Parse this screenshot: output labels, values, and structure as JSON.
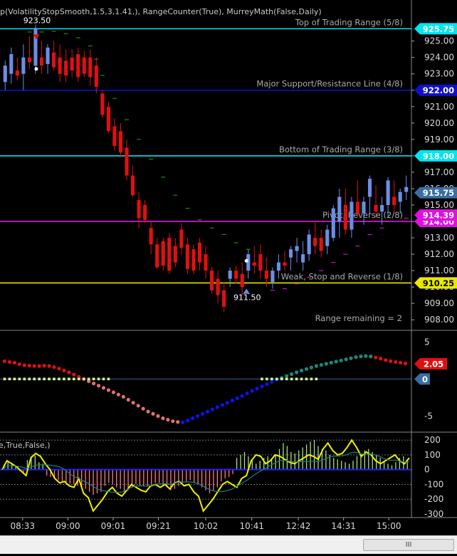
{
  "indicator_title": "p(VolatilityStopSmooth,1.5,3,1.41,),  RangeCounter(True),  MurreyMath(False,Daily)",
  "osc_title": "e,True,False,)",
  "colors": {
    "bull": "#6b8ee6",
    "bear": "#e01010",
    "cyan": "#00e5ee",
    "navy": "#1010cc",
    "magenta": "#e010e0",
    "yellow": "#e8e800",
    "price_tag": "#3a6ea5"
  },
  "scrollbar": {
    "thumb_label": "III"
  },
  "chart_data": [
    {
      "type": "candlestick",
      "name": "price",
      "y_axis_ticks": [
        908,
        909,
        910,
        911,
        912,
        913,
        914,
        915,
        916,
        917,
        918,
        919,
        920,
        921,
        922,
        923,
        924,
        925
      ],
      "y_tick_labels": [
        "908.00",
        "909.00",
        "910.00",
        "911.00",
        "912.00",
        "913.00",
        "914.00",
        "915.00",
        "916.00",
        "917.00",
        "918.00",
        "919.00",
        "920.00",
        "921.00",
        "922.00",
        "923.00",
        "924.00",
        "925.00"
      ],
      "ylim": [
        907.75,
        926.2
      ],
      "x_tick_labels": [
        "08:33",
        "09:00",
        "09:01",
        "09:21",
        "10:02",
        "10:41",
        "12:42",
        "14:31",
        "15:00"
      ],
      "murrey_lines": [
        {
          "label": "Top of Trading Range (5/8)",
          "value": 925.75,
          "tag": "925.75",
          "color": "cyan"
        },
        {
          "label": "Major Support/Resistance Line (4/8)",
          "value": 922.0,
          "tag": "922.00",
          "color": "navy"
        },
        {
          "label": "Bottom of Trading Range (3/8)",
          "value": 918.0,
          "tag": "918.00",
          "color": "cyan"
        },
        {
          "label": "Pivot, Reverse (2/8)",
          "value": 914.0,
          "tag": "914.00",
          "color": "magenta"
        },
        {
          "label": "Weak, Stop and Reverse (1/8)",
          "value": 910.25,
          "tag": "910.25",
          "color": "yellow"
        }
      ],
      "price_tags": [
        {
          "value": 915.75,
          "tag": "915.75",
          "color": "#3a6ea5"
        },
        {
          "value": 914.39,
          "tag": "914.39",
          "color": "#e010e0"
        }
      ],
      "annotations": [
        {
          "text": "923.50",
          "x_index": 5,
          "y": 926.1
        },
        {
          "text": "911.50",
          "x_index": 39,
          "y": 909.2
        }
      ],
      "range_text": "Range remaining = 2",
      "candles": [
        {
          "o": 922.5,
          "h": 923.8,
          "l": 922.0,
          "c": 923.5
        },
        {
          "o": 923.0,
          "h": 924.6,
          "l": 922.4,
          "c": 924.2
        },
        {
          "o": 923.2,
          "h": 924.0,
          "l": 922.6,
          "c": 922.9
        },
        {
          "o": 923.0,
          "h": 924.8,
          "l": 922.0,
          "c": 924.0
        },
        {
          "o": 924.0,
          "h": 925.3,
          "l": 923.3,
          "c": 923.7
        },
        {
          "o": 923.5,
          "h": 926.0,
          "l": 923.0,
          "c": 925.8
        },
        {
          "o": 924.0,
          "h": 925.0,
          "l": 923.0,
          "c": 923.5
        },
        {
          "o": 923.6,
          "h": 924.8,
          "l": 923.0,
          "c": 924.6
        },
        {
          "o": 924.3,
          "h": 925.0,
          "l": 923.2,
          "c": 923.4
        },
        {
          "o": 924.0,
          "h": 924.8,
          "l": 922.5,
          "c": 923.0
        },
        {
          "o": 923.8,
          "h": 924.5,
          "l": 922.5,
          "c": 922.9
        },
        {
          "o": 924.0,
          "h": 924.5,
          "l": 922.8,
          "c": 923.2
        },
        {
          "o": 924.2,
          "h": 924.6,
          "l": 922.5,
          "c": 922.8
        },
        {
          "o": 924.0,
          "h": 924.4,
          "l": 922.8,
          "c": 923.0
        },
        {
          "o": 924.0,
          "h": 924.5,
          "l": 922.3,
          "c": 922.8
        },
        {
          "o": 923.5,
          "h": 924.0,
          "l": 921.8,
          "c": 922.2
        },
        {
          "o": 921.8,
          "h": 922.0,
          "l": 920.3,
          "c": 920.5
        },
        {
          "o": 921.0,
          "h": 921.3,
          "l": 919.4,
          "c": 919.5
        },
        {
          "o": 919.8,
          "h": 920.3,
          "l": 918.3,
          "c": 918.6
        },
        {
          "o": 919.5,
          "h": 920.0,
          "l": 917.9,
          "c": 918.2
        },
        {
          "o": 918.5,
          "h": 919.0,
          "l": 916.5,
          "c": 916.8
        },
        {
          "o": 916.8,
          "h": 917.4,
          "l": 915.5,
          "c": 915.6
        },
        {
          "o": 915.3,
          "h": 915.8,
          "l": 913.6,
          "c": 914.2
        },
        {
          "o": 915.0,
          "h": 915.3,
          "l": 913.9,
          "c": 914.1
        },
        {
          "o": 913.6,
          "h": 914.0,
          "l": 912.0,
          "c": 912.6
        },
        {
          "o": 912.6,
          "h": 913.0,
          "l": 911.1,
          "c": 911.2
        },
        {
          "o": 912.8,
          "h": 913.0,
          "l": 911.0,
          "c": 911.3
        },
        {
          "o": 913.0,
          "h": 913.3,
          "l": 910.8,
          "c": 911.0
        },
        {
          "o": 912.5,
          "h": 913.0,
          "l": 911.2,
          "c": 911.5
        },
        {
          "o": 913.5,
          "h": 913.9,
          "l": 912.0,
          "c": 912.4
        },
        {
          "o": 912.6,
          "h": 913.0,
          "l": 910.8,
          "c": 911.1
        },
        {
          "o": 912.3,
          "h": 912.6,
          "l": 910.8,
          "c": 911.0
        },
        {
          "o": 912.7,
          "h": 913.0,
          "l": 911.0,
          "c": 911.5
        },
        {
          "o": 912.0,
          "h": 912.5,
          "l": 910.5,
          "c": 911.0
        },
        {
          "o": 911.0,
          "h": 911.2,
          "l": 909.6,
          "c": 909.8
        },
        {
          "o": 910.5,
          "h": 911.0,
          "l": 909.0,
          "c": 909.5
        },
        {
          "o": 909.8,
          "h": 910.3,
          "l": 908.5,
          "c": 908.8
        },
        {
          "o": 910.5,
          "h": 911.2,
          "l": 910.0,
          "c": 911.0
        },
        {
          "o": 911.0,
          "h": 911.3,
          "l": 910.2,
          "c": 910.5
        },
        {
          "o": 910.8,
          "h": 911.5,
          "l": 909.5,
          "c": 910.0
        },
        {
          "o": 911.0,
          "h": 912.3,
          "l": 910.5,
          "c": 912.0
        },
        {
          "o": 911.5,
          "h": 912.5,
          "l": 910.8,
          "c": 911.3
        },
        {
          "o": 912.0,
          "h": 912.6,
          "l": 910.5,
          "c": 911.0
        },
        {
          "o": 911.0,
          "h": 911.8,
          "l": 910.0,
          "c": 910.5
        },
        {
          "o": 910.3,
          "h": 911.2,
          "l": 909.9,
          "c": 911.0
        },
        {
          "o": 911.0,
          "h": 912.0,
          "l": 910.5,
          "c": 911.5
        },
        {
          "o": 911.5,
          "h": 912.2,
          "l": 911.0,
          "c": 911.3
        },
        {
          "o": 911.8,
          "h": 912.5,
          "l": 911.0,
          "c": 912.3
        },
        {
          "o": 912.2,
          "h": 913.0,
          "l": 911.5,
          "c": 912.5
        },
        {
          "o": 911.5,
          "h": 912.8,
          "l": 911.0,
          "c": 912.0
        },
        {
          "o": 912.0,
          "h": 913.5,
          "l": 911.6,
          "c": 913.2
        },
        {
          "o": 913.0,
          "h": 914.0,
          "l": 912.0,
          "c": 912.5
        },
        {
          "o": 913.0,
          "h": 913.5,
          "l": 911.8,
          "c": 912.2
        },
        {
          "o": 912.5,
          "h": 913.8,
          "l": 912.0,
          "c": 913.5
        },
        {
          "o": 913.0,
          "h": 915.0,
          "l": 912.8,
          "c": 914.8
        },
        {
          "o": 914.0,
          "h": 916.0,
          "l": 913.0,
          "c": 915.5
        },
        {
          "o": 915.0,
          "h": 916.0,
          "l": 913.2,
          "c": 913.5
        },
        {
          "o": 913.5,
          "h": 915.5,
          "l": 913.0,
          "c": 915.2
        },
        {
          "o": 915.2,
          "h": 916.5,
          "l": 914.3,
          "c": 914.5
        },
        {
          "o": 914.5,
          "h": 915.5,
          "l": 913.8,
          "c": 915.2
        },
        {
          "o": 915.5,
          "h": 916.8,
          "l": 914.5,
          "c": 916.6
        },
        {
          "o": 915.0,
          "h": 916.2,
          "l": 914.2,
          "c": 914.6
        },
        {
          "o": 914.6,
          "h": 915.5,
          "l": 913.8,
          "c": 915.0
        },
        {
          "o": 915.0,
          "h": 916.7,
          "l": 914.3,
          "c": 916.5
        },
        {
          "o": 915.5,
          "h": 916.5,
          "l": 914.6,
          "c": 915.0
        },
        {
          "o": 915.2,
          "h": 916.0,
          "l": 914.5,
          "c": 915.8
        },
        {
          "o": 915.8,
          "h": 916.8,
          "l": 915.3,
          "c": 916.1
        }
      ],
      "stop_line": [
        {
          "x_index": 4,
          "y": 925.55,
          "side": "above"
        },
        {
          "x_index": 6,
          "y": 925.55,
          "side": "above"
        },
        {
          "x_index": 8,
          "y": 925.6,
          "side": "above"
        },
        {
          "x_index": 10,
          "y": 925.45,
          "side": "above"
        },
        {
          "x_index": 12,
          "y": 925.2,
          "side": "above"
        },
        {
          "x_index": 14,
          "y": 924.7,
          "side": "above"
        },
        {
          "x_index": 15,
          "y": 923.9,
          "side": "above"
        },
        {
          "x_index": 16,
          "y": 922.9,
          "side": "above"
        },
        {
          "x_index": 18,
          "y": 921.5,
          "side": "above"
        },
        {
          "x_index": 20,
          "y": 920.2,
          "side": "above"
        },
        {
          "x_index": 22,
          "y": 919.0,
          "side": "above"
        },
        {
          "x_index": 24,
          "y": 917.8,
          "side": "above"
        },
        {
          "x_index": 26,
          "y": 916.7,
          "side": "above"
        },
        {
          "x_index": 28,
          "y": 915.6,
          "side": "above"
        },
        {
          "x_index": 30,
          "y": 914.8,
          "side": "above"
        },
        {
          "x_index": 32,
          "y": 914.1,
          "side": "above"
        },
        {
          "x_index": 34,
          "y": 913.6,
          "side": "above"
        },
        {
          "x_index": 36,
          "y": 913.2,
          "side": "above"
        },
        {
          "x_index": 38,
          "y": 912.7,
          "side": "above"
        },
        {
          "x_index": 40,
          "y": 912.3,
          "side": "above"
        },
        {
          "x_index": 42,
          "y": 911.5,
          "side": "above"
        },
        {
          "x_index": 44,
          "y": 909.8,
          "side": "below"
        },
        {
          "x_index": 46,
          "y": 909.9,
          "side": "below"
        },
        {
          "x_index": 48,
          "y": 910.2,
          "side": "below"
        },
        {
          "x_index": 50,
          "y": 910.6,
          "side": "below"
        },
        {
          "x_index": 52,
          "y": 911.0,
          "side": "below"
        },
        {
          "x_index": 54,
          "y": 911.5,
          "side": "below"
        },
        {
          "x_index": 56,
          "y": 912.0,
          "side": "below"
        },
        {
          "x_index": 58,
          "y": 912.5,
          "side": "below"
        },
        {
          "x_index": 60,
          "y": 913.2,
          "side": "below"
        },
        {
          "x_index": 62,
          "y": 913.6,
          "side": "below"
        },
        {
          "x_index": 64,
          "y": 914.0,
          "side": "below"
        },
        {
          "x_index": 66,
          "y": 914.2,
          "side": "below"
        }
      ]
    },
    {
      "type": "dots",
      "name": "momentum",
      "y_tick_labels": [
        "5",
        "-5"
      ],
      "y_ticks": [
        5,
        -5
      ],
      "ylim": [
        -6.5,
        5.8
      ],
      "tags": [
        {
          "value": 2.05,
          "tag": "2.05",
          "color": "#e01010"
        },
        {
          "value": 0,
          "tag": "0",
          "color": "#3a6ea5"
        }
      ],
      "values": [
        2.4,
        2.3,
        2.2,
        2.0,
        1.85,
        1.8,
        1.75,
        1.75,
        1.8,
        1.75,
        1.6,
        1.4,
        1.15,
        0.9,
        0.6,
        0.3,
        0.0,
        -0.3,
        -0.6,
        -0.9,
        -1.2,
        -1.5,
        -1.8,
        -2.1,
        -2.4,
        -2.8,
        -3.2,
        -3.6,
        -4.0,
        -4.4,
        -4.7,
        -5.0,
        -5.3,
        -5.5,
        -5.7,
        -5.8,
        -5.85,
        -5.6,
        -5.3,
        -5.0,
        -4.7,
        -4.4,
        -4.1,
        -3.8,
        -3.5,
        -3.2,
        -2.9,
        -2.6,
        -2.3,
        -1.95,
        -1.6,
        -1.3,
        -1.0,
        -0.7,
        -0.4,
        -0.1,
        0.15,
        0.4,
        0.65,
        0.9,
        1.15,
        1.35,
        1.55,
        1.75,
        1.9,
        2.05,
        2.2,
        2.35,
        2.5,
        2.65,
        2.8,
        2.95,
        3.05,
        3.1,
        3.05,
        2.9,
        2.75,
        2.55,
        2.4,
        2.3,
        2.2,
        2.1
      ]
    },
    {
      "type": "bar_line",
      "name": "oscillator",
      "y_ticks": [
        200,
        100,
        0,
        -100,
        -200,
        -300
      ],
      "y_tick_labels": [
        "200",
        "100",
        "0",
        "-100",
        "-200",
        "-300"
      ],
      "ylim": [
        -310,
        225
      ],
      "bars": [
        35,
        60,
        40,
        25,
        -10,
        -30,
        65,
        90,
        95,
        50,
        40,
        -40,
        -50,
        -60,
        -70,
        -80,
        -90,
        -95,
        -100,
        -110,
        -120,
        -130,
        -150,
        -170,
        -160,
        -150,
        -110,
        -90,
        -100,
        -120,
        -130,
        -150,
        -140,
        -120,
        -100,
        -105,
        -110,
        -115,
        -100,
        -90,
        -90,
        -100,
        -120,
        -140,
        -130,
        -110,
        -90,
        -80,
        -70,
        -90,
        -100,
        -120,
        -140,
        -160,
        -140,
        -120,
        -80,
        -60,
        -50,
        -30,
        80,
        100,
        120,
        90,
        70,
        40,
        60,
        80,
        90,
        70,
        100,
        140,
        180,
        160,
        120,
        110,
        130,
        150,
        170,
        190,
        200,
        160,
        140,
        130,
        100,
        80,
        70,
        60,
        50,
        40,
        60,
        90,
        110,
        130,
        140,
        120,
        100,
        80,
        60,
        40,
        30,
        50,
        80,
        90,
        70
      ],
      "colors_up_down": [
        "#a8e080",
        "#ff7a8a"
      ],
      "line": [
        0,
        60,
        40,
        20,
        -10,
        -40,
        80,
        110,
        90,
        40,
        0,
        -60,
        -90,
        -80,
        -110,
        -120,
        -60,
        -160,
        -190,
        -280,
        -240,
        -200,
        -150,
        -120,
        -160,
        -180,
        -140,
        -100,
        -120,
        -140,
        -150,
        -110,
        -100,
        -120,
        -100,
        -130,
        -90,
        -80,
        -110,
        -100,
        -150,
        -180,
        -280,
        -240,
        -200,
        -150,
        -100,
        -80,
        -100,
        -120,
        -60,
        -40,
        60,
        100,
        90,
        40,
        60,
        100,
        90,
        70,
        50,
        40,
        60,
        80,
        100,
        90,
        70,
        140,
        180,
        130,
        100,
        110,
        150,
        200,
        150,
        90,
        120,
        100,
        60,
        40,
        60,
        80,
        100,
        60,
        40,
        80
      ]
    },
    {
      "type": "time_axis",
      "labels": [
        "08:33",
        "09:00",
        "09:01",
        "09:21",
        "10:02",
        "10:41",
        "12:42",
        "14:31",
        "15:00"
      ],
      "positions": [
        0.055,
        0.165,
        0.275,
        0.385,
        0.5,
        0.612,
        0.725,
        0.835,
        0.945
      ]
    }
  ]
}
